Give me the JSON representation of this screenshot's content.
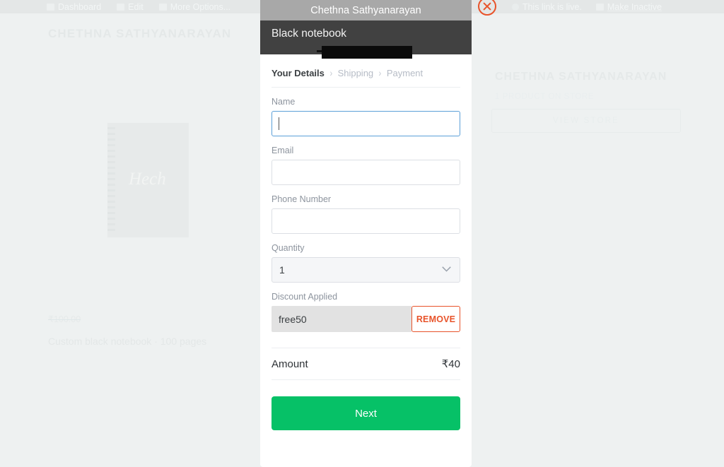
{
  "background": {
    "toolbar": {
      "left_items": [
        {
          "label": "Dashboard",
          "icon": "dashboard-icon"
        },
        {
          "label": "Edit",
          "icon": "edit-icon"
        },
        {
          "label": "More Options...",
          "icon": "more-options-icon"
        }
      ],
      "status_text": "This link is live.",
      "status_icon": "live-dot-icon",
      "make_inactive_label": "Make Inactive",
      "make_inactive_icon": "inactive-icon"
    },
    "left_panel": {
      "store_title": "CHETHNA SATHYANARAYAN",
      "product_image_script": "Hech",
      "struck_price": "₹100.00",
      "product_description": "Custom black notebook · 100 pages"
    },
    "right_panel": {
      "store_title": "CHETHNA SATHYANARAYAN",
      "product_count": "1 PRODUCT ON STORE",
      "view_store_label": "VIEW STORE"
    },
    "close_button_icon": "close-circle-icon"
  },
  "modal": {
    "titlebar": "Chethna Sathyanarayan",
    "product_name": "Black notebook",
    "breadcrumb": [
      {
        "label": "Your Details",
        "active": true
      },
      {
        "label": "Shipping",
        "active": false
      },
      {
        "label": "Payment",
        "active": false
      }
    ],
    "breadcrumb_separator": "›",
    "fields": {
      "name": {
        "label": "Name",
        "value": "",
        "placeholder": ""
      },
      "email": {
        "label": "Email",
        "value": "",
        "placeholder": ""
      },
      "phone": {
        "label": "Phone Number",
        "value": "",
        "placeholder": ""
      },
      "quantity": {
        "label": "Quantity",
        "value": "1",
        "chevron_icon": "chevron-down-icon"
      }
    },
    "discount": {
      "label": "Discount Applied",
      "code": "free50",
      "remove_label": "REMOVE"
    },
    "amount": {
      "label": "Amount",
      "value": "₹40"
    },
    "next_label": "Next"
  },
  "colors": {
    "accent_green": "#06c167",
    "accent_orange": "#e8532a",
    "focus_blue": "#5b9fd8",
    "titlebar_gray": "#a8a8a8",
    "dark_header": "#414141"
  }
}
